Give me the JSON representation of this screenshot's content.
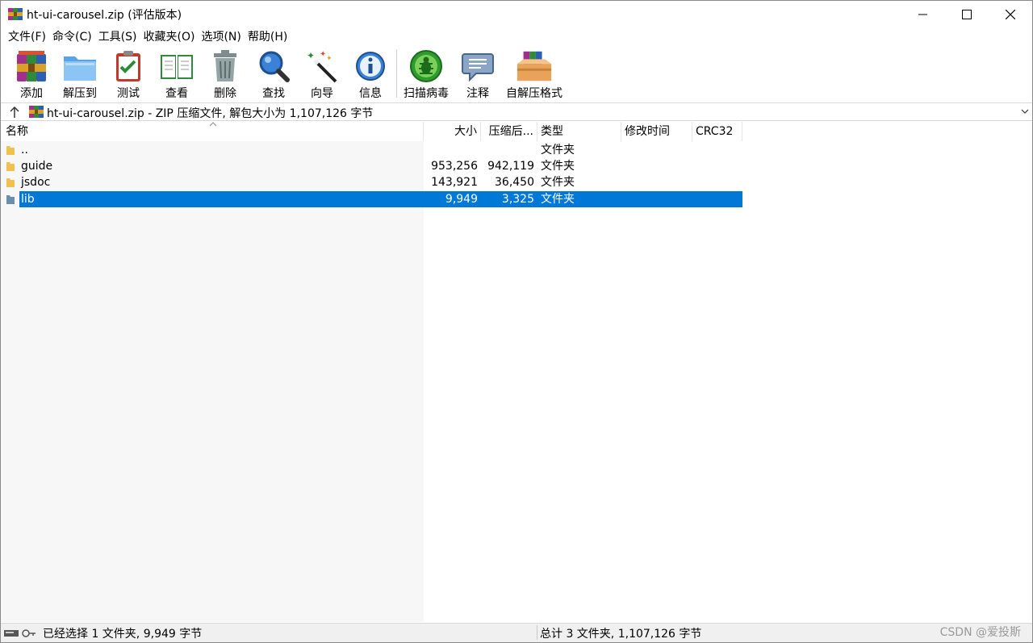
{
  "window": {
    "title": "ht-ui-carousel.zip (评估版本)"
  },
  "menu": [
    "文件(F)",
    "命令(C)",
    "工具(S)",
    "收藏夹(O)",
    "选项(N)",
    "帮助(H)"
  ],
  "toolbar": {
    "add": "添加",
    "extract": "解压到",
    "test": "测试",
    "view": "查看",
    "delete": "删除",
    "find": "查找",
    "wizard": "向导",
    "info": "信息",
    "virus_scan": "扫描病毒",
    "comment": "注释",
    "sfx": "自解压格式"
  },
  "address": {
    "text": "ht-ui-carousel.zip - ZIP 压缩文件, 解包大小为 1,107,126 字节"
  },
  "columns": {
    "name": "名称",
    "size": "大小",
    "packed": "压缩后...",
    "type": "类型",
    "modified": "修改时间",
    "crc": "CRC32"
  },
  "files": [
    {
      "name": "..",
      "size": "",
      "packed": "",
      "type": "文件夹"
    },
    {
      "name": "guide",
      "size": "953,256",
      "packed": "942,119",
      "type": "文件夹"
    },
    {
      "name": "jsdoc",
      "size": "143,921",
      "packed": "36,450",
      "type": "文件夹"
    },
    {
      "name": "lib",
      "size": "9,949",
      "packed": "3,325",
      "type": "文件夹"
    }
  ],
  "status": {
    "left": "已经选择 1 文件夹, 9,949 字节",
    "right": "总计 3 文件夹, 1,107,126 字节",
    "watermark": "CSDN @爱投斯"
  },
  "colors": {
    "selection": "#0078d7",
    "folder": "#f2c04d"
  }
}
